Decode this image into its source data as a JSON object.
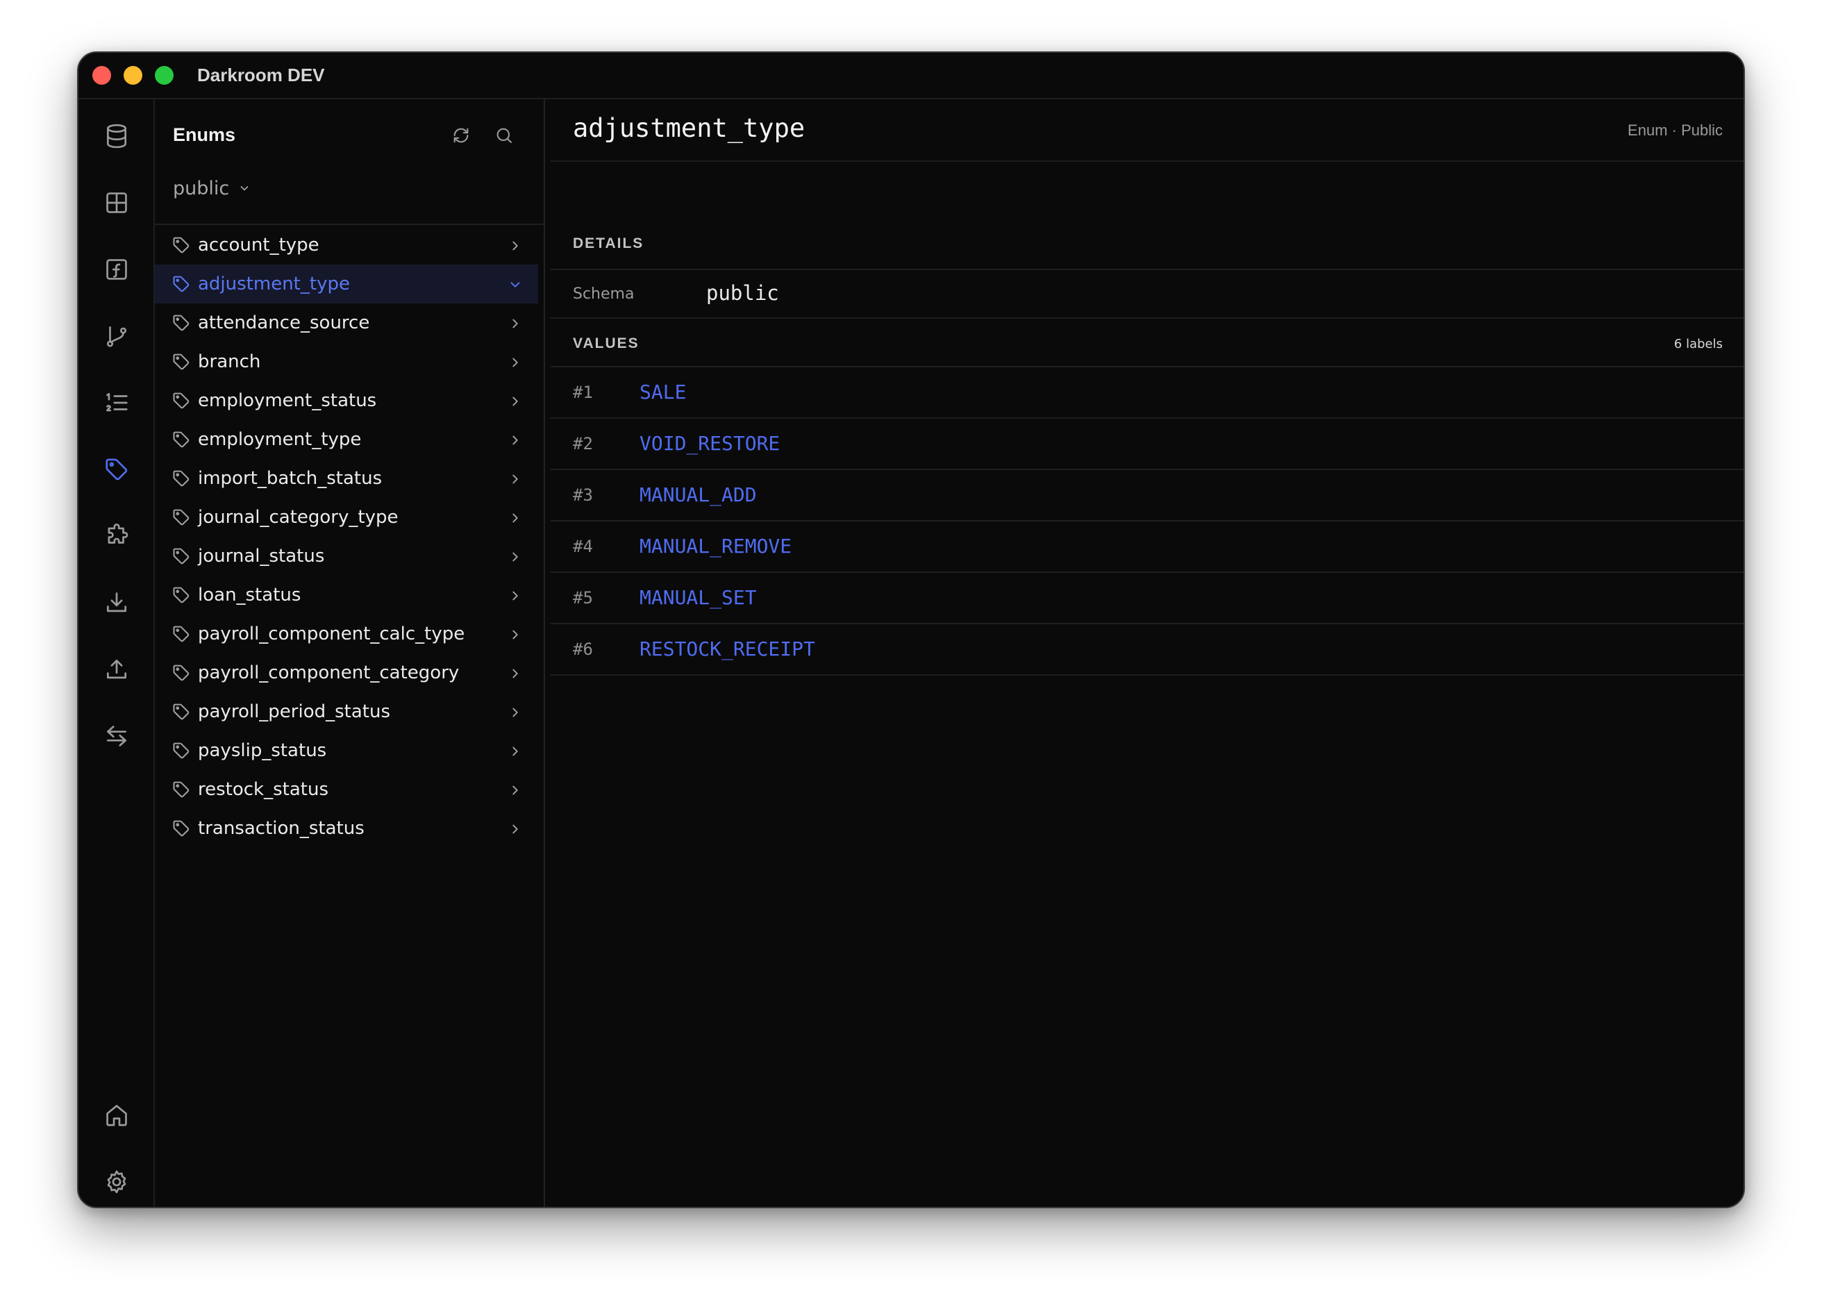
{
  "window": {
    "title": "Darkroom DEV"
  },
  "rail": {
    "top_icons": [
      "database-icon",
      "table-grid-icon",
      "function-icon",
      "git-branch-icon",
      "numbered-list-icon",
      "tag-icon",
      "puzzle-icon",
      "download-icon",
      "upload-icon",
      "swap-arrows-icon"
    ],
    "bottom_icons": [
      "home-icon",
      "settings-gear-icon"
    ],
    "active": "tag-icon",
    "accent_color": "#4f6cf0"
  },
  "sidebar": {
    "title": "Enums",
    "schema": "public",
    "tools": [
      "refresh-icon",
      "search-icon"
    ],
    "items": [
      {
        "label": "account_type",
        "selected": false
      },
      {
        "label": "adjustment_type",
        "selected": true
      },
      {
        "label": "attendance_source",
        "selected": false
      },
      {
        "label": "branch",
        "selected": false
      },
      {
        "label": "employment_status",
        "selected": false
      },
      {
        "label": "employment_type",
        "selected": false
      },
      {
        "label": "import_batch_status",
        "selected": false
      },
      {
        "label": "journal_category_type",
        "selected": false
      },
      {
        "label": "journal_status",
        "selected": false
      },
      {
        "label": "loan_status",
        "selected": false
      },
      {
        "label": "payroll_component_calc_type",
        "selected": false
      },
      {
        "label": "payroll_component_category",
        "selected": false
      },
      {
        "label": "payroll_period_status",
        "selected": false
      },
      {
        "label": "payslip_status",
        "selected": false
      },
      {
        "label": "restock_status",
        "selected": false
      },
      {
        "label": "transaction_status",
        "selected": false
      }
    ]
  },
  "main": {
    "title": "adjustment_type",
    "meta": "Enum · Public",
    "details_label": "DETAILS",
    "schema_key": "Schema",
    "schema_value": "public",
    "values_label": "VALUES",
    "values_count": "6 labels",
    "values": [
      {
        "num": "#1",
        "name": "SALE"
      },
      {
        "num": "#2",
        "name": "VOID_RESTORE"
      },
      {
        "num": "#3",
        "name": "MANUAL_ADD"
      },
      {
        "num": "#4",
        "name": "MANUAL_REMOVE"
      },
      {
        "num": "#5",
        "name": "MANUAL_SET"
      },
      {
        "num": "#6",
        "name": "RESTOCK_RECEIPT"
      }
    ]
  }
}
